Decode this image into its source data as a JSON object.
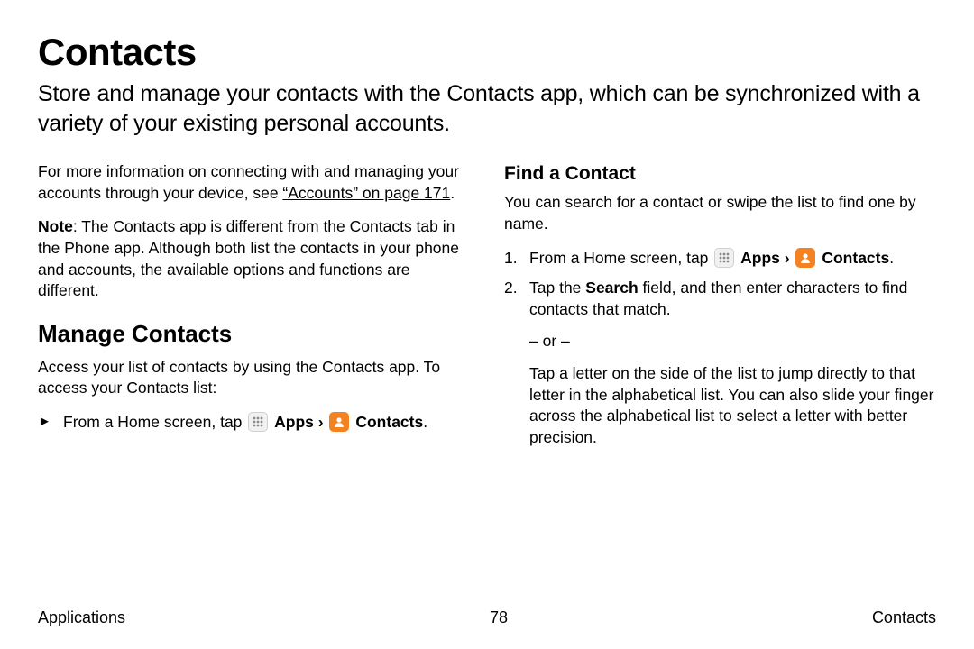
{
  "title": "Contacts",
  "intro": "Store and manage your contacts with the Contacts app, which can be synchronized with a variety of your existing personal accounts.",
  "left": {
    "para1_a": "For more information on connecting with and managing your accounts through your device, see ",
    "para1_link": "“Accounts” on page 171",
    "para1_b": ".",
    "note_label": "Note",
    "note_body": ": The Contacts app is different from the Contacts tab in the Phone app. Although both list the contacts in your phone and accounts, the available options and functions are different.",
    "h2": "Manage Contacts",
    "manage_para": "Access your list of contacts by using the Contacts app. To access your Contacts list:",
    "step_marker": "►",
    "step_a": "From a Home screen, tap ",
    "apps_label": "Apps",
    "sep": " › ",
    "contacts_label": "Contacts",
    "step_end": "."
  },
  "right": {
    "h3": "Find a Contact",
    "find_para": "You can search for a contact or swipe the list to find one by name.",
    "step1_num": "1.",
    "step1_a": "From a Home screen, tap ",
    "apps_label": "Apps",
    "sep": " › ",
    "contacts_label": "Contacts",
    "step1_end": ".",
    "step2_num": "2.",
    "step2_a": "Tap the ",
    "step2_bold": "Search",
    "step2_b": " field, and then enter characters to find contacts that match.",
    "or": "– or –",
    "step2_alt": "Tap a letter on the side of the list to jump directly to that letter in the alphabetical list. You can also slide your finger across the alphabetical list to select a letter with better precision."
  },
  "footer": {
    "left": "Applications",
    "center": "78",
    "right": "Contacts"
  }
}
